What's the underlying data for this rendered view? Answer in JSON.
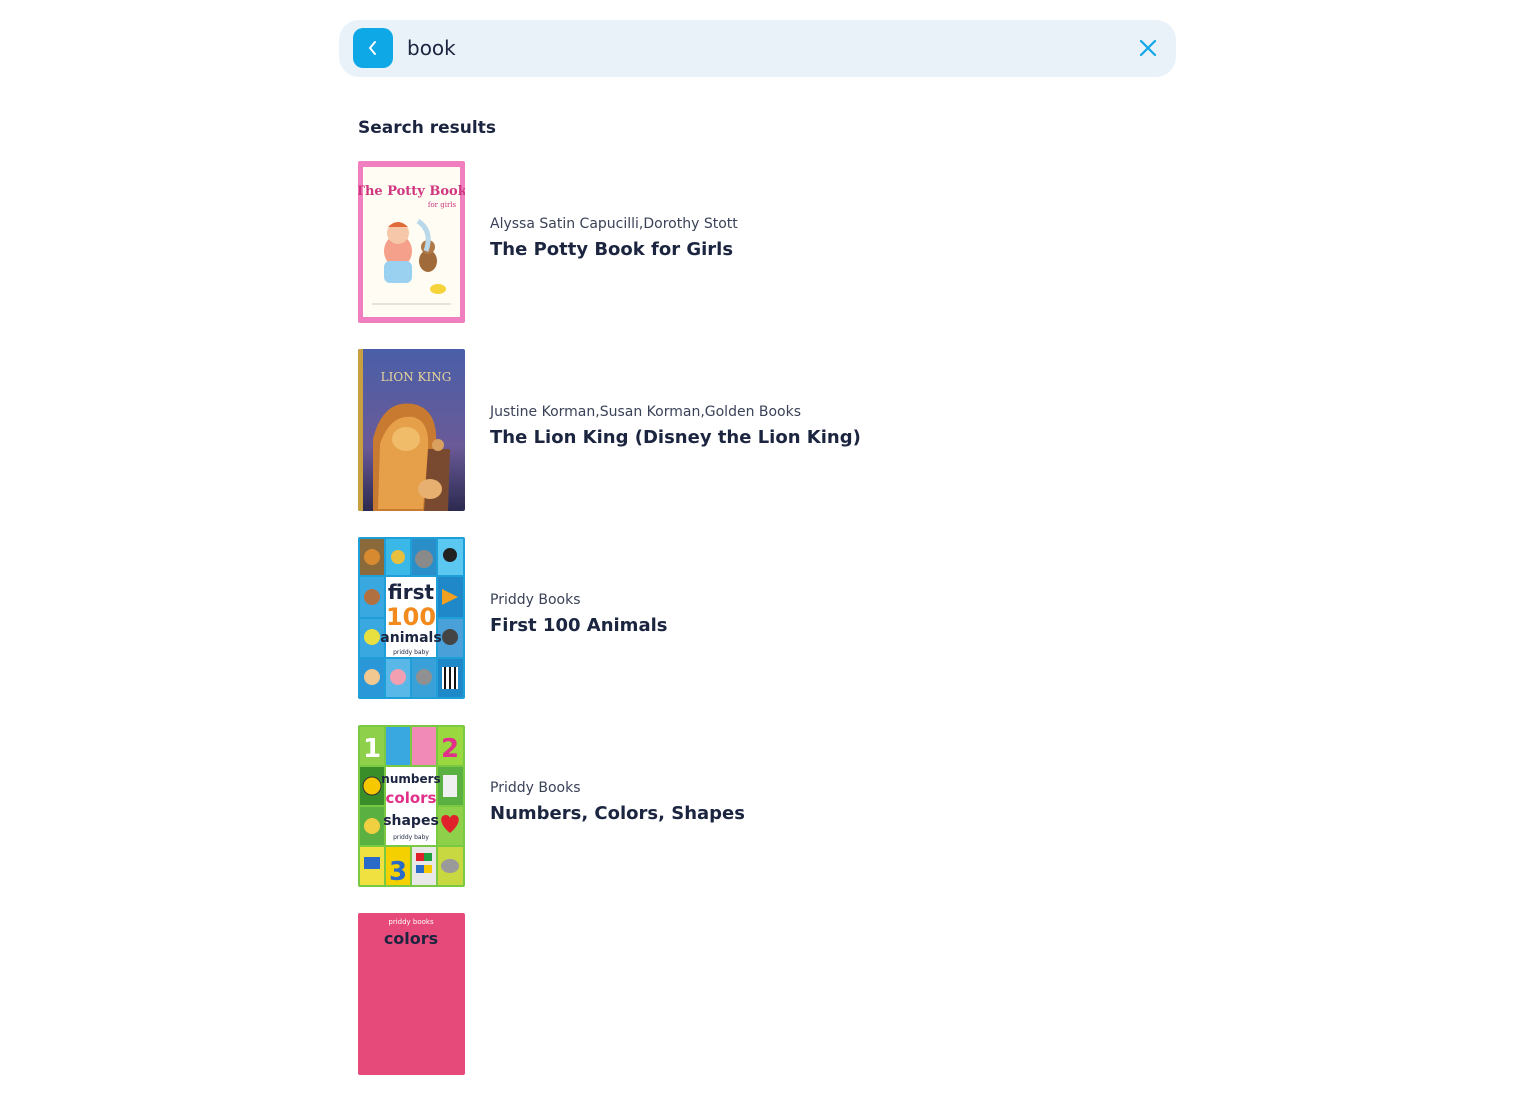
{
  "search": {
    "query": "book",
    "back_icon": "chevron-left-icon",
    "clear_icon": "close-icon",
    "accent": "#0ea8e6",
    "bar_bg": "#eaf2f9"
  },
  "results": {
    "heading": "Search results",
    "items": [
      {
        "author": "Alyssa Satin Capucilli,Dorothy Stott",
        "title": "The Potty Book for Girls",
        "cover_title": "The Potty Book",
        "cover_sub": "for girls"
      },
      {
        "author": "Justine Korman,Susan Korman,Golden Books",
        "title": "The Lion King (Disney the Lion King)",
        "cover_title": "LION KING"
      },
      {
        "author": "Priddy Books",
        "title": "First 100 Animals",
        "cover_line1": "first",
        "cover_line2": "100",
        "cover_line3": "animals",
        "cover_brand": "priddy baby"
      },
      {
        "author": "Priddy Books",
        "title": "Numbers, Colors, Shapes",
        "cover_line1": "numbers",
        "cover_line2": "colors",
        "cover_line3": "shapes",
        "cover_brand": "priddy baby"
      },
      {
        "author": "",
        "title": "",
        "cover_brand": "priddy books",
        "cover_title": "colors"
      }
    ]
  }
}
